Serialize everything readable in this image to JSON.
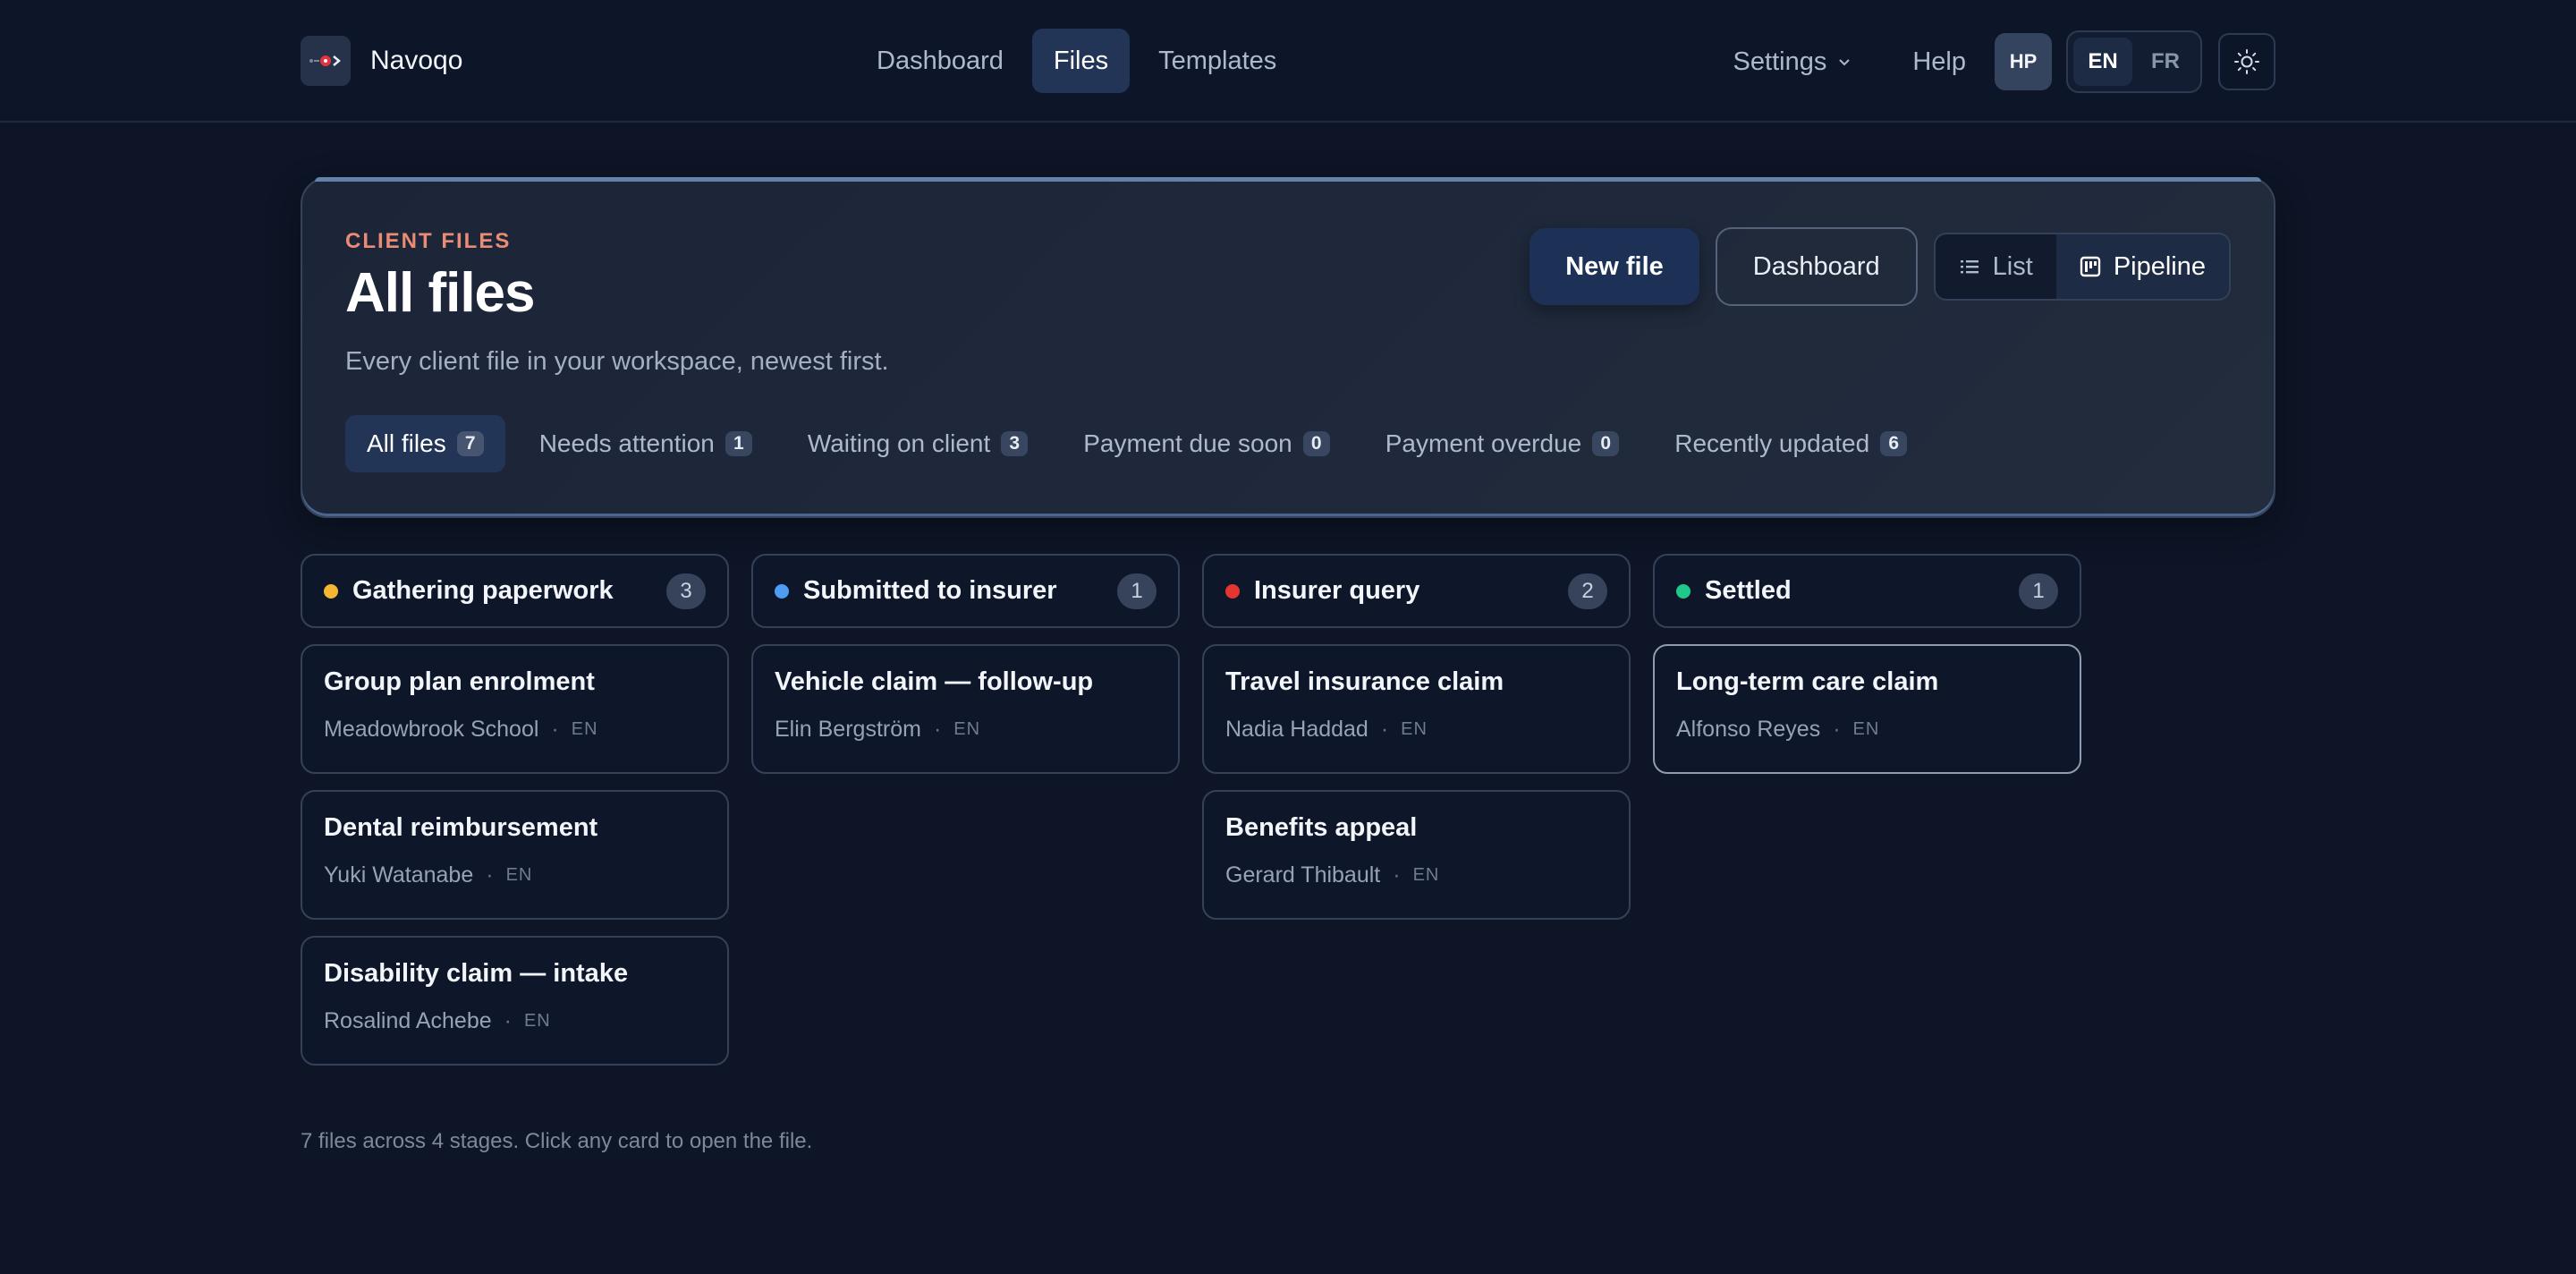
{
  "app": {
    "name": "Navoqo"
  },
  "nav": {
    "items": [
      {
        "label": "Dashboard",
        "active": false
      },
      {
        "label": "Files",
        "active": true
      },
      {
        "label": "Templates",
        "active": false
      }
    ]
  },
  "right_nav": {
    "settings_label": "Settings",
    "help_label": "Help",
    "avatar_initials": "HP",
    "languages": [
      "EN",
      "FR"
    ],
    "active_language": "EN"
  },
  "header": {
    "eyebrow": "CLIENT FILES",
    "title": "All files",
    "subtitle": "Every client file in your workspace, newest first.",
    "new_file_label": "New file",
    "dashboard_label": "Dashboard",
    "view_list_label": "List",
    "view_pipeline_label": "Pipeline",
    "active_view": "Pipeline"
  },
  "filters": [
    {
      "label": "All files",
      "count": "7",
      "active": true
    },
    {
      "label": "Needs attention",
      "count": "1",
      "active": false
    },
    {
      "label": "Waiting on client",
      "count": "3",
      "active": false
    },
    {
      "label": "Payment due soon",
      "count": "0",
      "active": false
    },
    {
      "label": "Payment overdue",
      "count": "0",
      "active": false
    },
    {
      "label": "Recently updated",
      "count": "6",
      "active": false
    }
  ],
  "columns": [
    {
      "title": "Gathering paperwork",
      "count": "3",
      "color": "#f5b731",
      "cards": [
        {
          "title": "Group plan enrolment",
          "client": "Meadowbrook School",
          "lang": "EN"
        },
        {
          "title": "Dental reimbursement",
          "client": "Yuki Watanabe",
          "lang": "EN"
        },
        {
          "title": "Disability claim — intake",
          "client": "Rosalind Achebe",
          "lang": "EN"
        }
      ]
    },
    {
      "title": "Submitted to insurer",
      "count": "1",
      "color": "#4d9df5",
      "cards": [
        {
          "title": "Vehicle claim — follow-up",
          "client": "Elin Bergström",
          "lang": "EN"
        }
      ]
    },
    {
      "title": "Insurer query",
      "count": "2",
      "color": "#e5352f",
      "cards": [
        {
          "title": "Travel insurance claim",
          "client": "Nadia Haddad",
          "lang": "EN"
        },
        {
          "title": "Benefits appeal",
          "client": "Gerard Thibault",
          "lang": "EN"
        }
      ]
    },
    {
      "title": "Settled",
      "count": "1",
      "color": "#1fc98a",
      "cards": [
        {
          "title": "Long-term care claim",
          "client": "Alfonso Reyes",
          "lang": "EN",
          "selected": true
        }
      ]
    }
  ],
  "footer": {
    "note": "7 files across 4 stages. Click any card to open the file."
  }
}
